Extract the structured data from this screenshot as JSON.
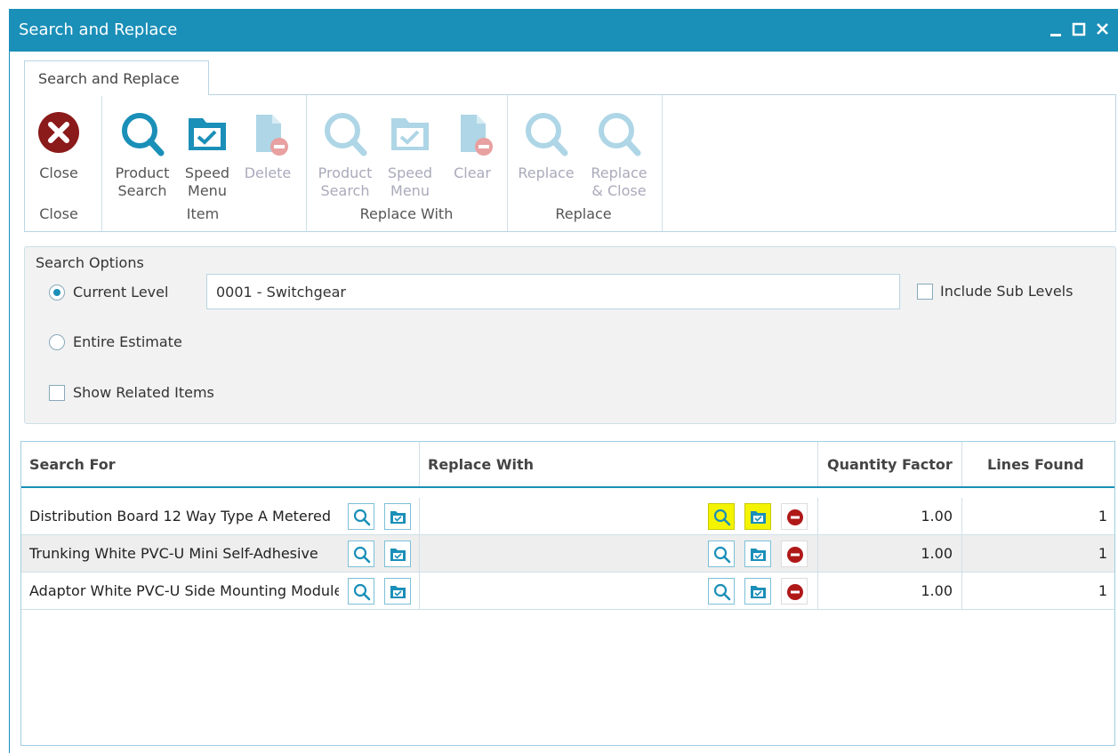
{
  "window": {
    "title": "Search and Replace"
  },
  "ribbon": {
    "tab_label": "Search and Replace",
    "groups": {
      "close": {
        "label": "Close",
        "buttons": {
          "close": {
            "line1": "Close",
            "line2": ""
          }
        }
      },
      "item": {
        "label": "Item",
        "buttons": {
          "product_search": {
            "line1": "Product",
            "line2": "Search"
          },
          "speed_menu": {
            "line1": "Speed",
            "line2": "Menu"
          },
          "delete": {
            "line1": "Delete",
            "line2": ""
          }
        }
      },
      "replace_with": {
        "label": "Replace With",
        "buttons": {
          "product_search": {
            "line1": "Product",
            "line2": "Search"
          },
          "speed_menu": {
            "line1": "Speed",
            "line2": "Menu"
          },
          "clear": {
            "line1": "Clear",
            "line2": ""
          }
        }
      },
      "replace": {
        "label": "Replace",
        "buttons": {
          "replace": {
            "line1": "Replace",
            "line2": ""
          },
          "replace_close": {
            "line1": "Replace",
            "line2": "& Close"
          }
        }
      }
    }
  },
  "search_options": {
    "legend": "Search Options",
    "current_level_label": "Current Level",
    "current_level_value": "0001 - Switchgear",
    "include_sub_levels_label": "Include Sub Levels",
    "entire_estimate_label": "Entire Estimate",
    "show_related_label": "Show Related Items"
  },
  "grid": {
    "columns": [
      "Search For",
      "Replace With",
      "Quantity Factor",
      "Lines Found"
    ],
    "rows": [
      {
        "search_for": "Distribution Board 12 Way Type A Metered",
        "replace_with": "",
        "quantity_factor": "1.00",
        "lines_found": "1"
      },
      {
        "search_for": "Trunking White PVC-U Mini Self-Adhesive",
        "replace_with": "",
        "quantity_factor": "1.00",
        "lines_found": "1"
      },
      {
        "search_for": "Adaptor White PVC-U Side Mounting Module",
        "replace_with": "",
        "quantity_factor": "1.00",
        "lines_found": "1"
      }
    ]
  },
  "colors": {
    "accent": "#1a8fb8",
    "highlight": "#f4f400",
    "danger": "#b01818",
    "close_red": "#8b1a1a"
  }
}
